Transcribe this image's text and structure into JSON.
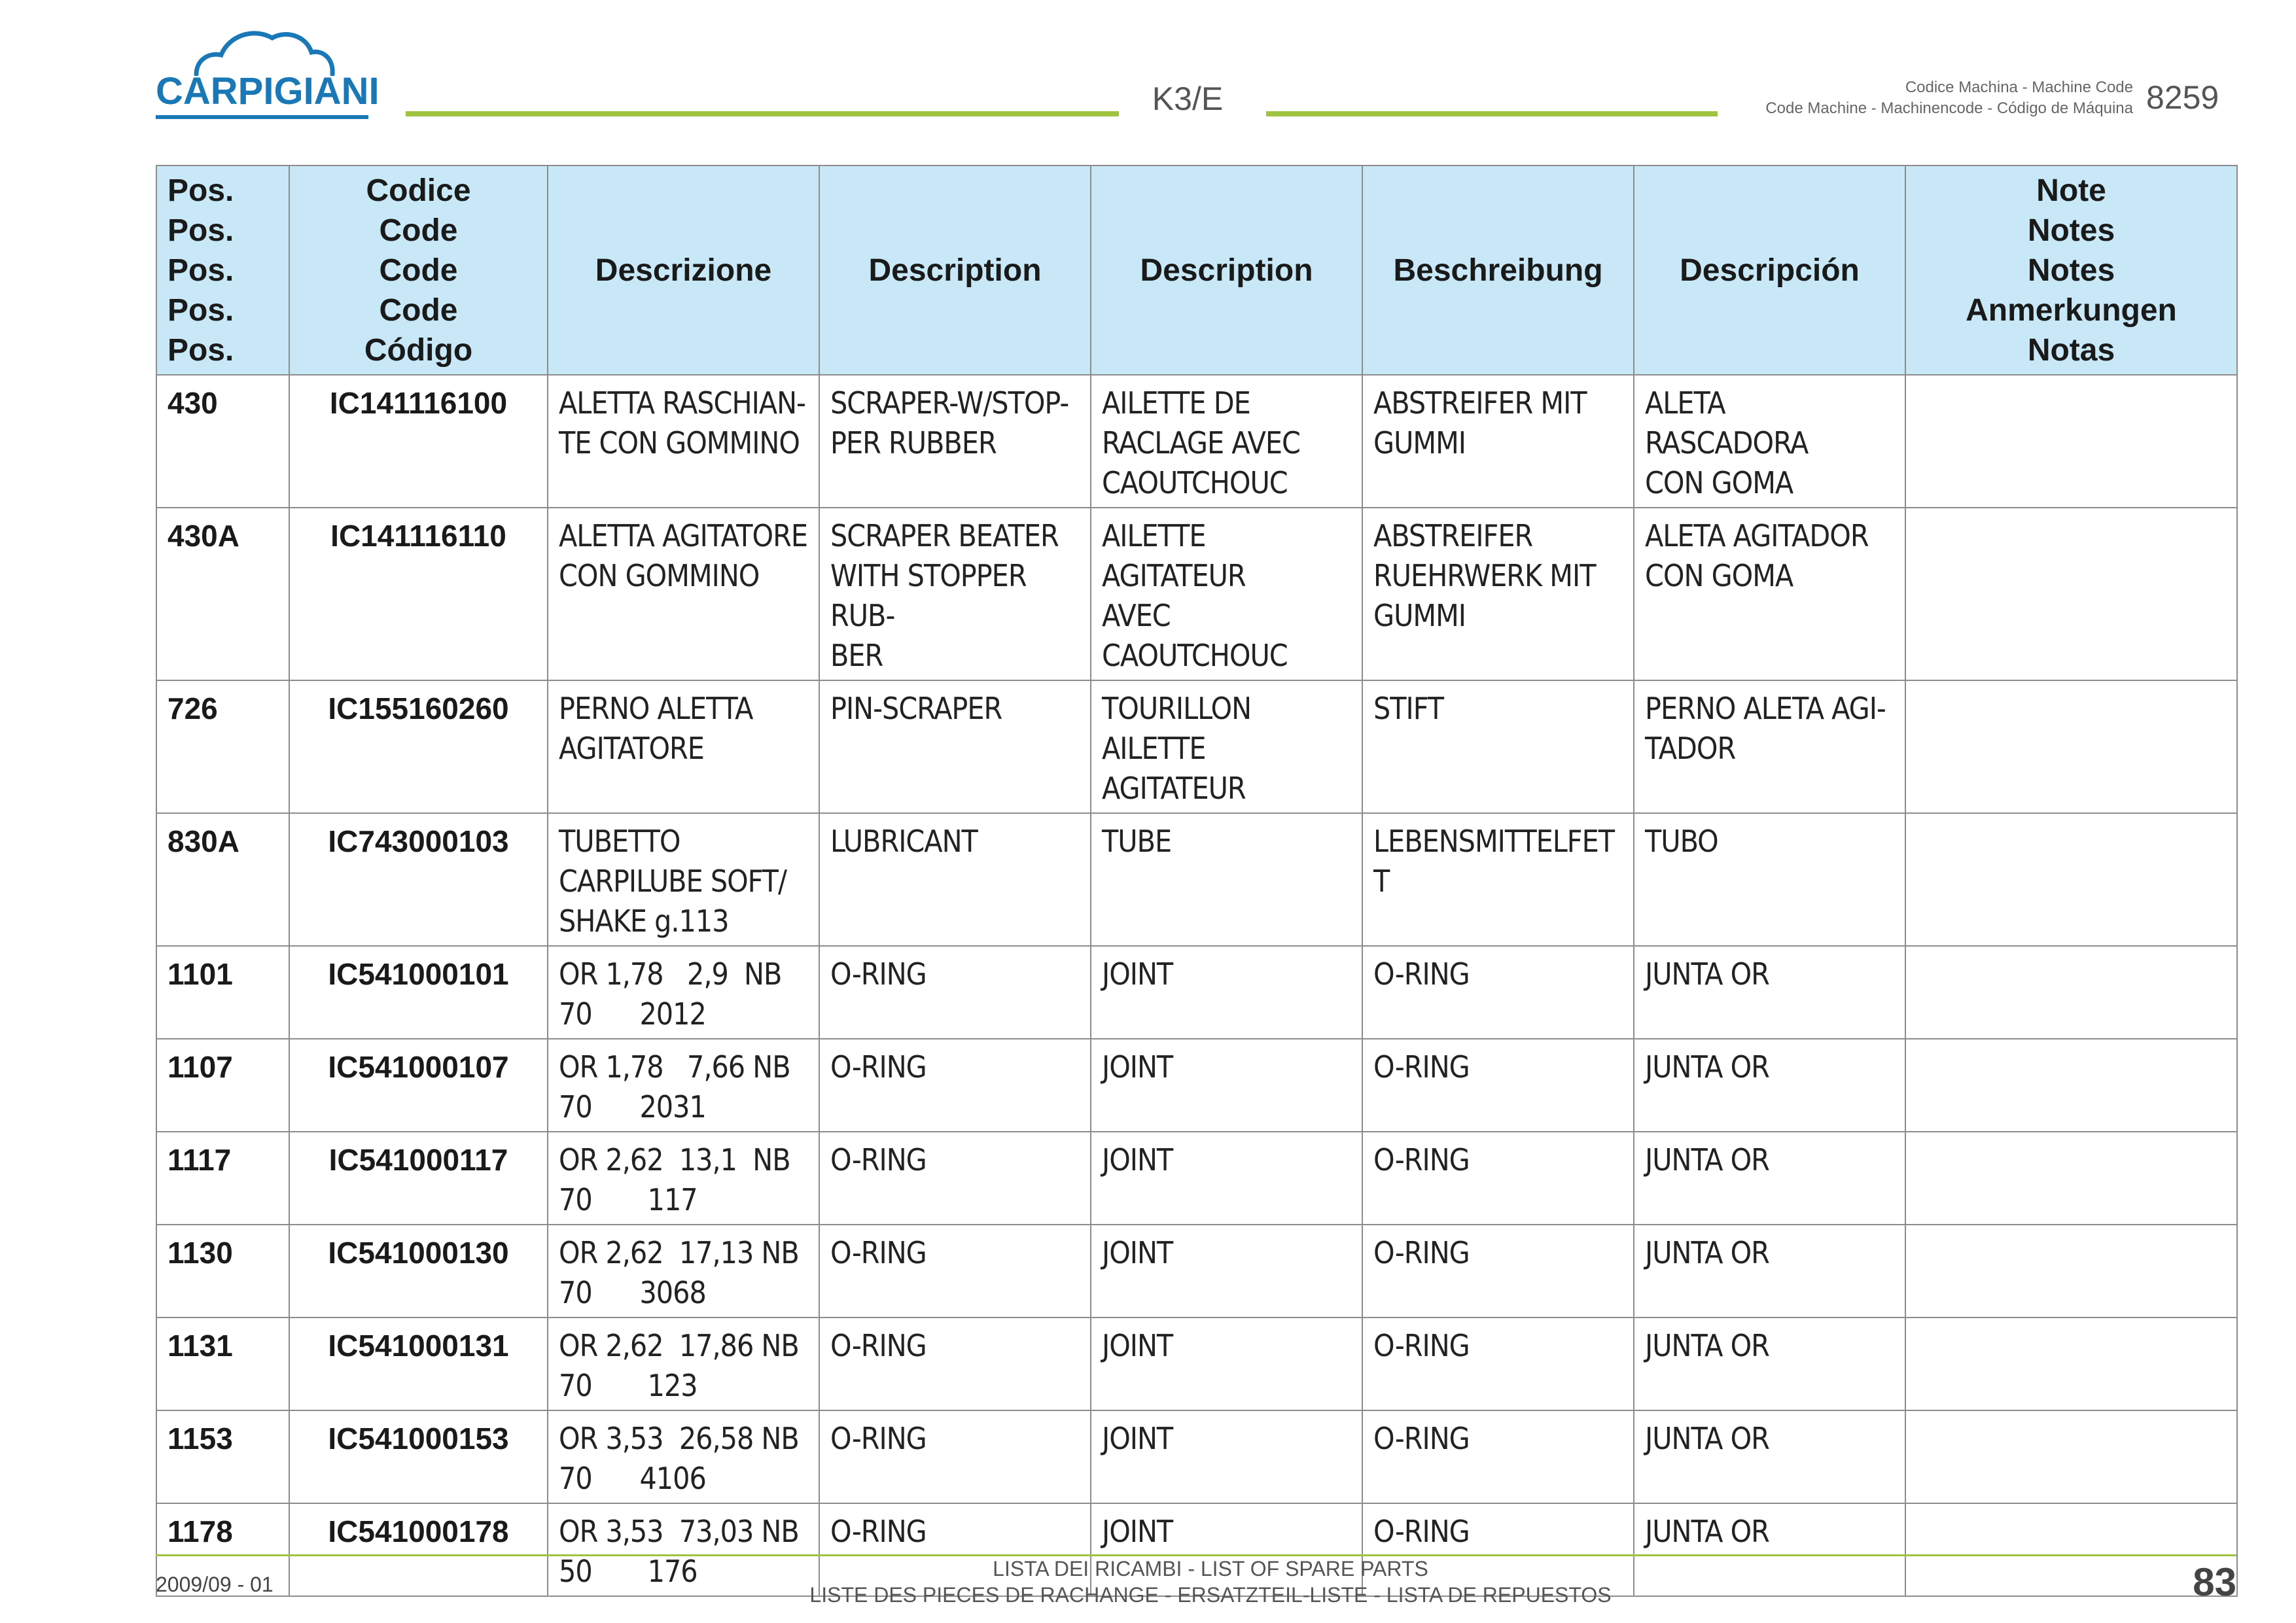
{
  "header": {
    "logo_text": "CARPIGIANI",
    "model": "K3/E",
    "machine_code_label_1": "Codice Machina - Machine Code",
    "machine_code_label_2": "Code Machine - Machinencode - Código de Máquina",
    "machine_code": "8259"
  },
  "table": {
    "headers": {
      "pos": [
        "Pos.",
        "Pos.",
        "Pos.",
        "Pos.",
        "Pos."
      ],
      "code": [
        "Codice",
        "Code",
        "Code",
        "Code",
        "Código"
      ],
      "desc_it": "Descrizione",
      "desc_en": "Description",
      "desc_fr": "Description",
      "desc_de": "Beschreibung",
      "desc_es": "Descripción",
      "notes": [
        "Note",
        "Notes",
        "Notes",
        "Anmerkungen",
        "Notas"
      ]
    },
    "rows": [
      {
        "pos": "430",
        "code": "IC141116100",
        "it": "ALETTA RASCHIAN-\nTE CON GOMMINO",
        "en": "SCRAPER-W/STOP-\nPER RUBBER",
        "fr": "AILETTE DE\nRACLAGE AVEC\nCAOUTCHOUC",
        "de": "ABSTREIFER MIT\nGUMMI",
        "es": "ALETA RASCADORA\nCON GOMA",
        "notes": ""
      },
      {
        "pos": "430A",
        "code": "IC141116110",
        "it": "ALETTA AGITATORE\nCON GOMMINO",
        "en": "SCRAPER BEATER\nWITH STOPPER RUB-\nBER",
        "fr": "AILETTE AGITATEUR\nAVEC CAOUTCHOUC",
        "de": "ABSTREIFER\nRUEHRWERK MIT\nGUMMI",
        "es": "ALETA AGITADOR\nCON GOMA",
        "notes": ""
      },
      {
        "pos": "726",
        "code": "IC155160260",
        "it": "PERNO ALETTA\nAGITATORE",
        "en": "PIN-SCRAPER",
        "fr": "TOURILLON AILETTE\nAGITATEUR",
        "de": "STIFT",
        "es": "PERNO ALETA AGI-\nTADOR",
        "notes": ""
      },
      {
        "pos": "830A",
        "code": "IC743000103",
        "it": "TUBETTO\nCARPILUBE SOFT/\nSHAKE g.113",
        "en": "LUBRICANT",
        "fr": "TUBE",
        "de": "LEBENSMITTELFETT",
        "es": "TUBO",
        "notes": ""
      },
      {
        "pos": "1101",
        "code": "IC541000101",
        "it": "OR 1,78   2,9  NB\n70      2012",
        "en": "O-RING",
        "fr": "JOINT",
        "de": "O-RING",
        "es": "JUNTA OR",
        "notes": ""
      },
      {
        "pos": "1107",
        "code": "IC541000107",
        "it": "OR 1,78   7,66 NB\n70      2031",
        "en": "O-RING",
        "fr": "JOINT",
        "de": "O-RING",
        "es": "JUNTA OR",
        "notes": ""
      },
      {
        "pos": "1117",
        "code": "IC541000117",
        "it": "OR 2,62  13,1  NB\n70       117",
        "en": "O-RING",
        "fr": "JOINT",
        "de": "O-RING",
        "es": "JUNTA OR",
        "notes": ""
      },
      {
        "pos": "1130",
        "code": "IC541000130",
        "it": "OR 2,62  17,13 NB\n70      3068",
        "en": "O-RING",
        "fr": "JOINT",
        "de": "O-RING",
        "es": "JUNTA OR",
        "notes": ""
      },
      {
        "pos": "1131",
        "code": "IC541000131",
        "it": "OR 2,62  17,86 NB\n70       123",
        "en": "O-RING",
        "fr": "JOINT",
        "de": "O-RING",
        "es": "JUNTA OR",
        "notes": ""
      },
      {
        "pos": "1153",
        "code": "IC541000153",
        "it": "OR 3,53  26,58 NB\n70      4106",
        "en": "O-RING",
        "fr": "JOINT",
        "de": "O-RING",
        "es": "JUNTA OR",
        "notes": ""
      },
      {
        "pos": "1178",
        "code": "IC541000178",
        "it": "OR 3,53  73,03 NB\n50       176",
        "en": "O-RING",
        "fr": "JOINT",
        "de": "O-RING",
        "es": "JUNTA OR",
        "notes": ""
      }
    ]
  },
  "footer": {
    "date": "2009/09 - 01",
    "line1": "LISTA DEI RICAMBI - LIST OF SPARE PARTS",
    "line2": "LISTE DES PIECES DE RACHANGE - ERSATZTEIL-LISTE - LISTA DE REPUESTOS",
    "page": "83"
  },
  "colors": {
    "brand_blue": "#1b78b7",
    "accent_green": "#9fc441",
    "header_fill": "#c8e8f7"
  }
}
